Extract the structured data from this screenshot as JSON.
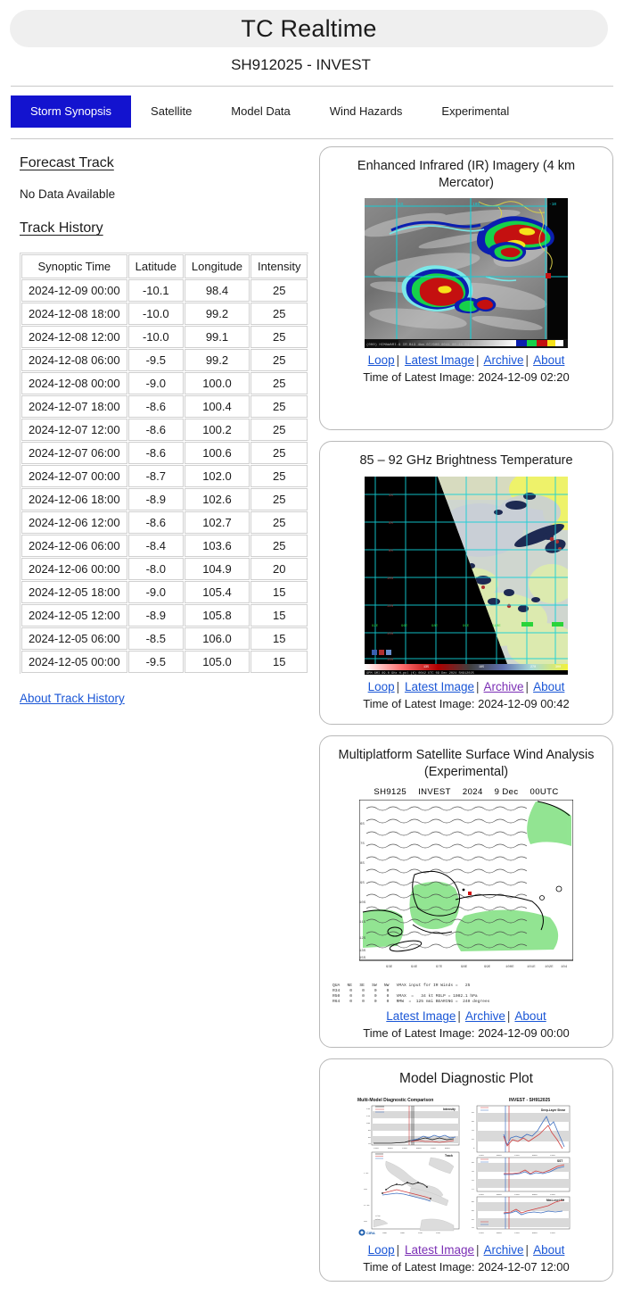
{
  "header": {
    "app_title": "TC Realtime",
    "storm_id": "SH912025 - INVEST"
  },
  "tabs": [
    {
      "label": "Storm Synopsis",
      "active": true
    },
    {
      "label": "Satellite",
      "active": false
    },
    {
      "label": "Model Data",
      "active": false
    },
    {
      "label": "Wind Hazards",
      "active": false
    },
    {
      "label": "Experimental",
      "active": false
    }
  ],
  "left": {
    "forecast_heading": "Forecast Track",
    "forecast_nodata": "No Data Available",
    "track_heading": "Track History",
    "about_link": "About Track History",
    "columns": [
      "Synoptic Time",
      "Latitude",
      "Longitude",
      "Intensity"
    ],
    "rows": [
      [
        "2024-12-09 00:00",
        "-10.1",
        "98.4",
        "25"
      ],
      [
        "2024-12-08 18:00",
        "-10.0",
        "99.2",
        "25"
      ],
      [
        "2024-12-08 12:00",
        "-10.0",
        "99.1",
        "25"
      ],
      [
        "2024-12-08 06:00",
        "-9.5",
        "99.2",
        "25"
      ],
      [
        "2024-12-08 00:00",
        "-9.0",
        "100.0",
        "25"
      ],
      [
        "2024-12-07 18:00",
        "-8.6",
        "100.4",
        "25"
      ],
      [
        "2024-12-07 12:00",
        "-8.6",
        "100.2",
        "25"
      ],
      [
        "2024-12-07 06:00",
        "-8.6",
        "100.6",
        "25"
      ],
      [
        "2024-12-07 00:00",
        "-8.7",
        "102.0",
        "25"
      ],
      [
        "2024-12-06 18:00",
        "-8.9",
        "102.6",
        "25"
      ],
      [
        "2024-12-06 12:00",
        "-8.6",
        "102.7",
        "25"
      ],
      [
        "2024-12-06 06:00",
        "-8.4",
        "103.6",
        "25"
      ],
      [
        "2024-12-06 00:00",
        "-8.0",
        "104.9",
        "20"
      ],
      [
        "2024-12-05 18:00",
        "-9.0",
        "105.4",
        "15"
      ],
      [
        "2024-12-05 12:00",
        "-8.9",
        "105.8",
        "15"
      ],
      [
        "2024-12-05 06:00",
        "-8.5",
        "106.0",
        "15"
      ],
      [
        "2024-12-05 00:00",
        "-9.5",
        "105.0",
        "15"
      ]
    ]
  },
  "cards": [
    {
      "title": "Enhanced Infrared (IR) Imagery (4 km Mercator)",
      "links": [
        "Loop",
        "Latest Image",
        "Archive",
        "About"
      ],
      "visited": [],
      "time_label": "Time of Latest Image: 2024-12-09 02:20"
    },
    {
      "title": "85 – 92 GHz Brightness Temperature",
      "links": [
        "Loop",
        "Latest Image",
        "Archive",
        "About"
      ],
      "visited": [
        "Archive"
      ],
      "time_label": "Time of Latest Image: 2024-12-09 00:42",
      "colorbar_caption": "GPM GMI 89.0 GHz H-pol (K)     0042 UTC 09 Dec 2024              SH912025"
    },
    {
      "title": "Multiplatform Satellite Surface Wind Analysis (Experimental)",
      "plot_header": [
        "SH9125",
        "INVEST",
        "2024",
        "9 Dec",
        "00UTC"
      ],
      "links": [
        "Latest Image",
        "Archive",
        "About"
      ],
      "visited": [],
      "time_label": "Time of Latest Image: 2024-12-09 00:00",
      "wind_table": "QUA   NE   SE   SW   NW   VMAX input for IR Winds =   25\nR34    0    0    0    0\nR50    0    0    0    0   VMAX  =   34 kt MSLP = 1002.1 hPa\nR64    0    0    0    0   RMW  =  125 nmi BEARING =  240 degrees"
    },
    {
      "title": "Model Diagnostic Plot",
      "plot_labels": {
        "left_title": "Multi-Model Diagnostic Comparison",
        "right_title": "INVEST - SH912025",
        "panel1": "Intensity",
        "panel2": "Deep-Layer Shear",
        "panel3": "Track",
        "panel4": "SST",
        "panel5": "Mid-Level RH",
        "logo": "CIRA"
      },
      "links": [
        "Loop",
        "Latest Image",
        "Archive",
        "About"
      ],
      "visited": [
        "Latest Image"
      ],
      "time_label": "Time of Latest Image: 2024-12-07 12:00"
    }
  ],
  "colors": {
    "accent": "#1313cf",
    "link": "#1a56d6",
    "visited_link": "#7b2fb5",
    "pill_bg": "#efefef",
    "card_border": "#b9b9b9"
  }
}
